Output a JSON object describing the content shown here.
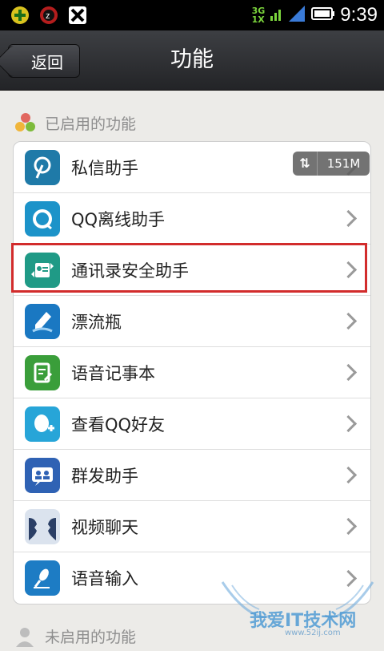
{
  "status_bar": {
    "net_top": "3G",
    "net_bottom": "1X",
    "clock": "9:39"
  },
  "title_bar": {
    "back_label": "返回",
    "title": "功能"
  },
  "enabled_section": {
    "header": "已启用的功能",
    "items": [
      {
        "label": "私信助手",
        "icon": "pen-icon",
        "color": "#1f7aa8"
      },
      {
        "label": "QQ离线助手",
        "icon": "qq-penguin-icon",
        "color": "#1c93c9"
      },
      {
        "label": "通讯录安全助手",
        "icon": "contacts-sync-icon",
        "color": "#1f9a86"
      },
      {
        "label": "漂流瓶",
        "icon": "bottle-icon",
        "color": "#1a78c2"
      },
      {
        "label": "语音记事本",
        "icon": "notepad-icon",
        "color": "#3a9e3a"
      },
      {
        "label": "查看QQ好友",
        "icon": "qq-friends-icon",
        "color": "#27a5d8"
      },
      {
        "label": "群发助手",
        "icon": "group-icon",
        "color": "#2f62b4"
      },
      {
        "label": "视频聊天",
        "icon": "faces-icon",
        "color": "#5b7fb5"
      },
      {
        "label": "语音输入",
        "icon": "microphone-icon",
        "color": "#1d7cc4"
      }
    ]
  },
  "memory_badge": {
    "value": "151M"
  },
  "disabled_section": {
    "header": "未启用的功能"
  },
  "watermark": {
    "text": "我爱IT技术网",
    "url": "www.52ij.com"
  }
}
